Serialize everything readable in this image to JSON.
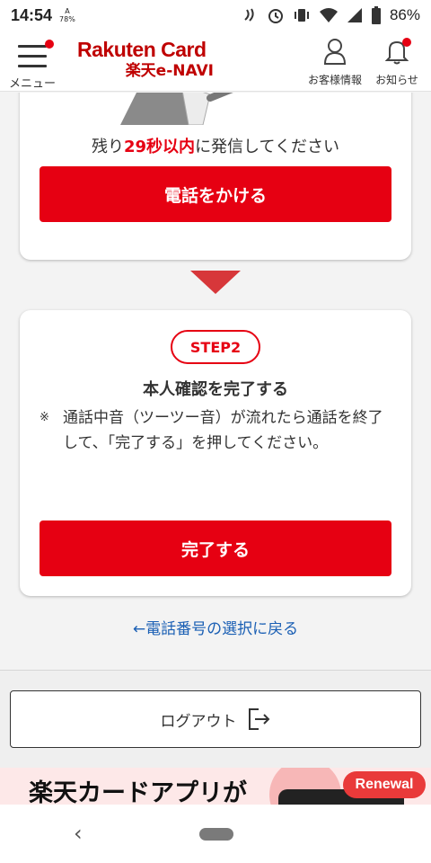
{
  "status_bar": {
    "time": "14:54",
    "small_indicator_top": "A",
    "small_indicator_bottom": "78%",
    "battery_percent": "86%"
  },
  "header": {
    "menu_label": "メニュー",
    "logo_line1": "Rakuten Card",
    "logo_line2": "楽天e-NAVI",
    "customer_info_label": "お客様情報",
    "notifications_label": "お知らせ"
  },
  "step1": {
    "remaining_prefix": "残り",
    "remaining_highlight": "29秒以内",
    "remaining_suffix": "に発信してください",
    "call_button": "電話をかける"
  },
  "step2": {
    "badge": "STEP2",
    "title": "本人確認を完了する",
    "note_mark": "※",
    "note_text": "通話中音（ツーツー音）が流れたら通話を終了して、「完了する」を押してください。",
    "complete_button": "完了する"
  },
  "back_link": "←電話番号の選択に戻る",
  "logout_label": "ログアウト",
  "banner": {
    "text": "楽天カードアプリが",
    "badge": "Renewal"
  },
  "colors": {
    "primary_red": "#e60012",
    "link_blue": "#1a5fb4",
    "brand_red": "#bf0000"
  }
}
